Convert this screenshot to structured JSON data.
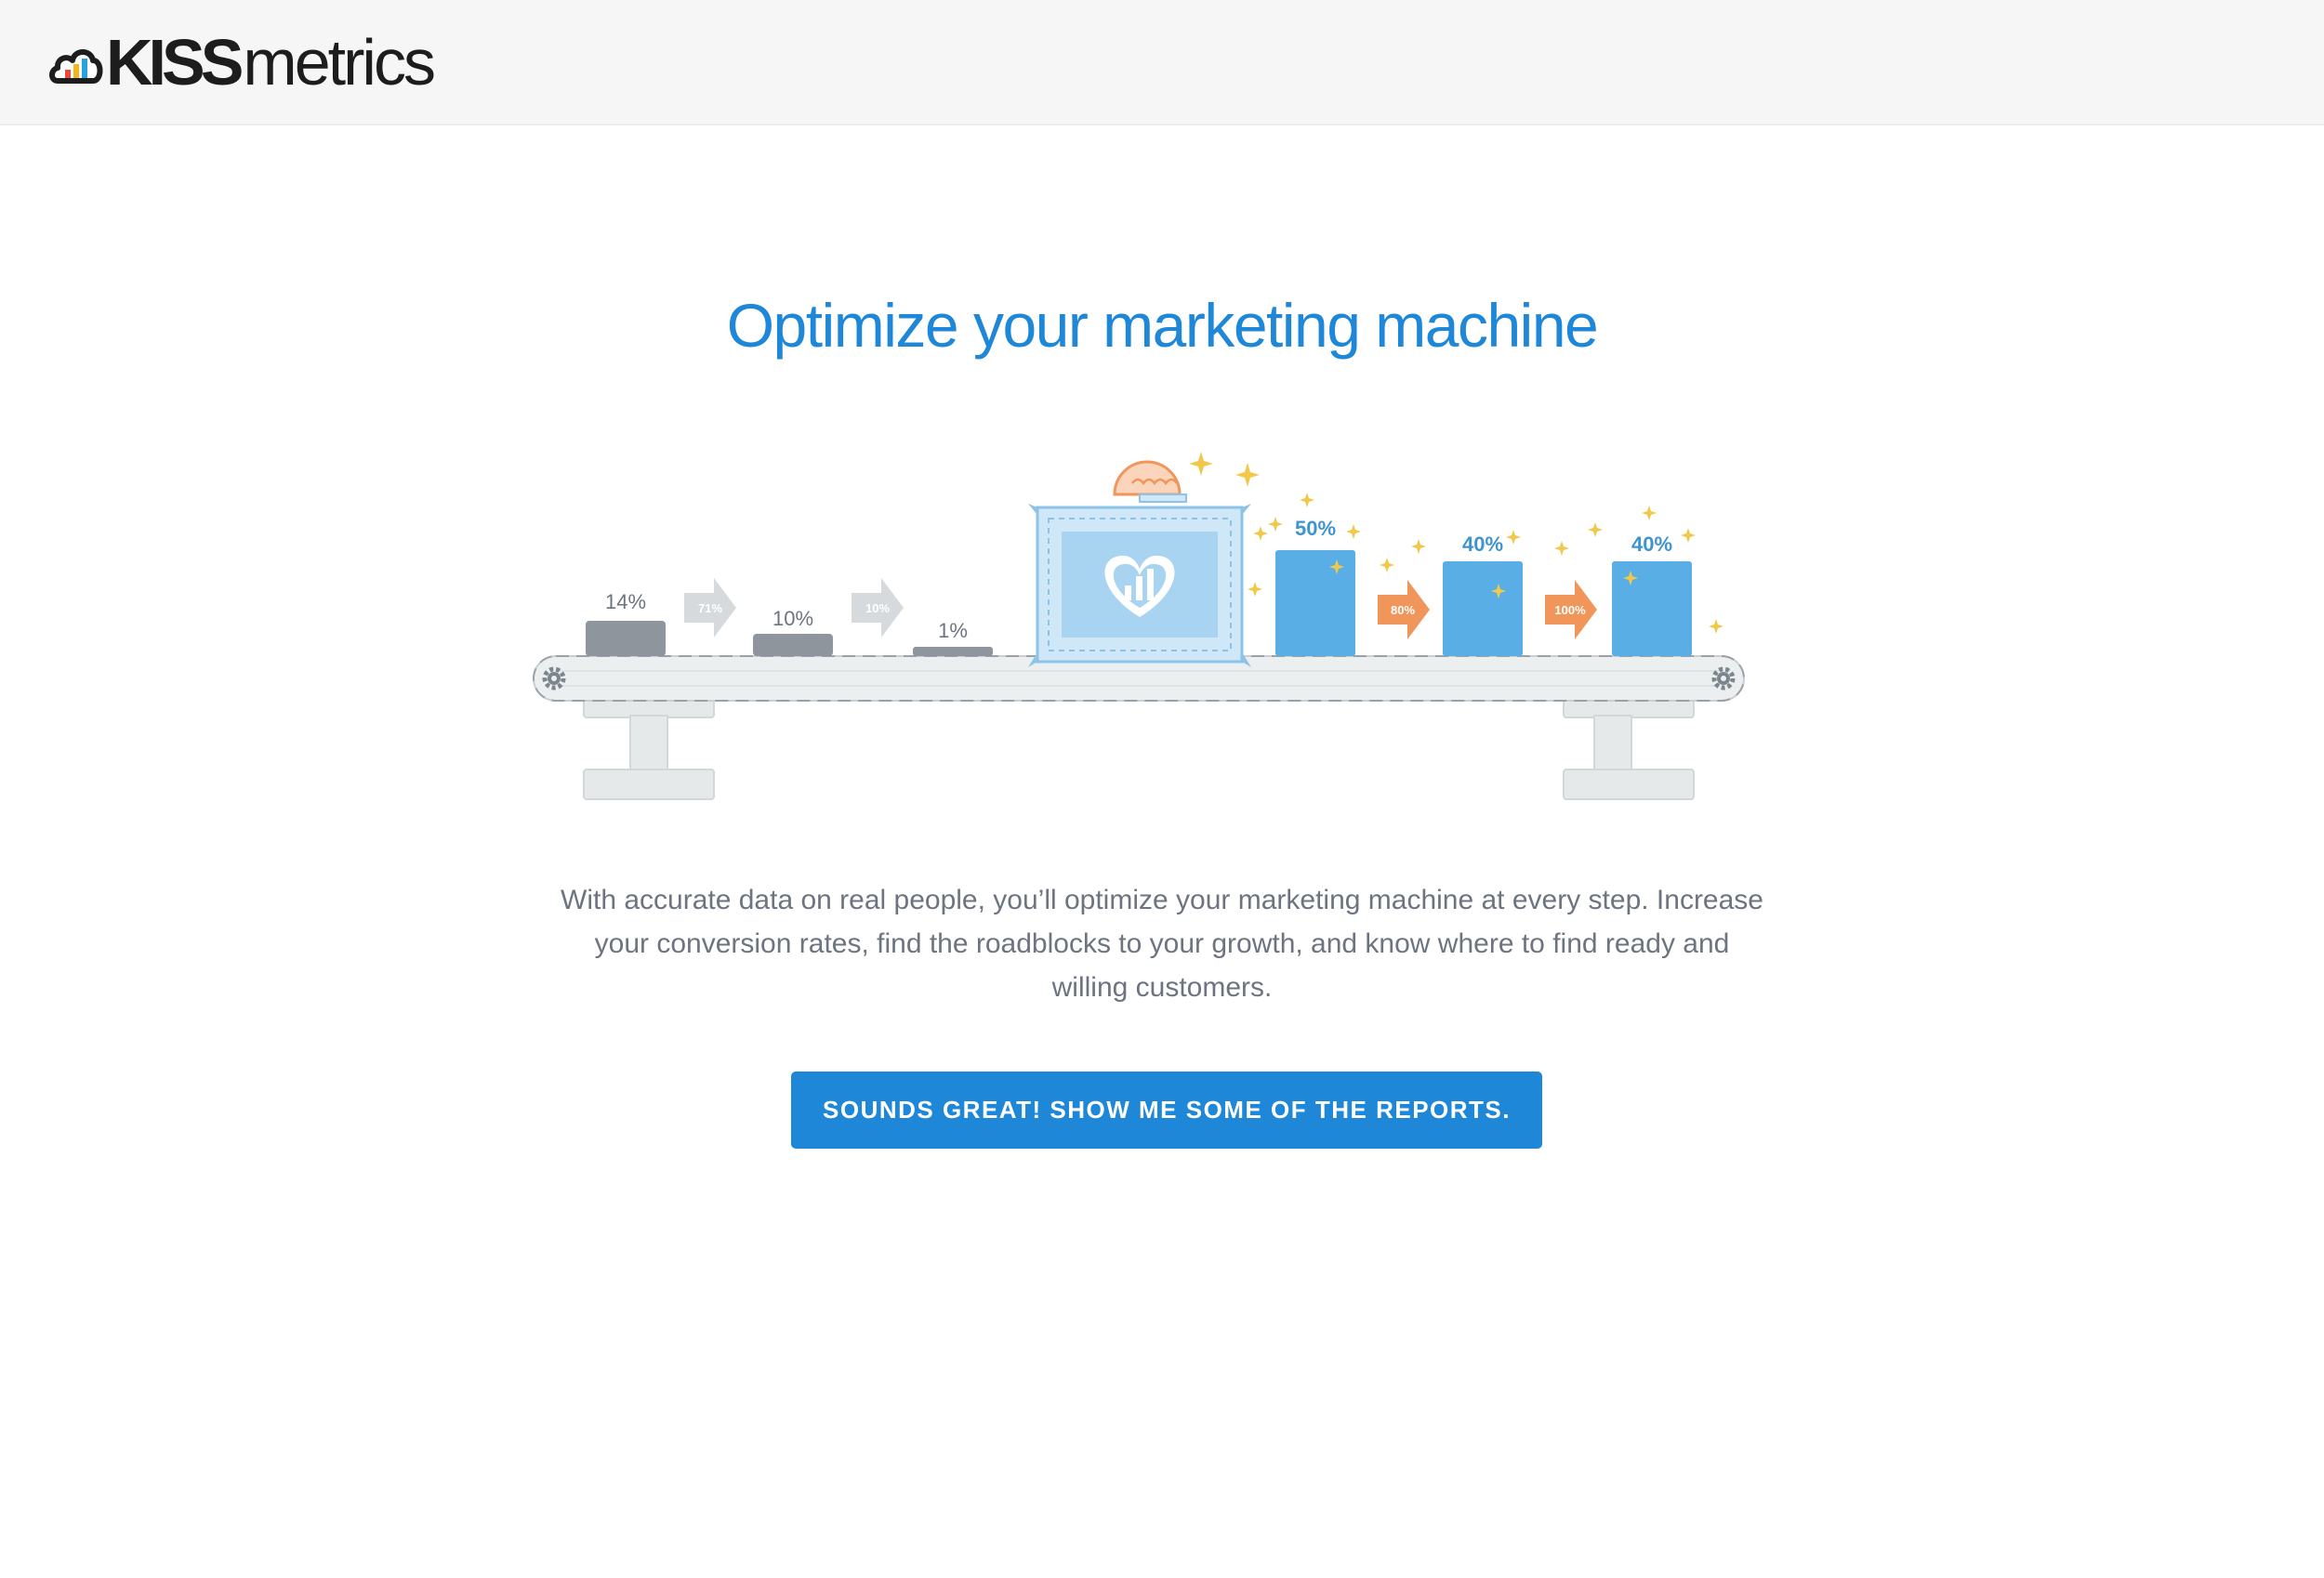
{
  "header": {
    "logo_bold": "KISS",
    "logo_light": "metrics"
  },
  "main": {
    "headline": "Optimize your marketing machine",
    "description": "With accurate data on real people, you’ll optimize your marketing machine at every step. Increase your conversion rates, find the roadblocks to your growth, and know where to find ready and willing customers.",
    "cta_label": "SOUNDS GREAT! SHOW ME SOME OF THE REPORTS."
  },
  "illustration": {
    "before_blocks": [
      {
        "label": "14%",
        "level": 14
      },
      {
        "label": "10%",
        "level": 10
      },
      {
        "label": "1%",
        "level": 1
      }
    ],
    "before_arrows": [
      "71%",
      "10%"
    ],
    "after_blocks": [
      {
        "label": "50%",
        "level": 50
      },
      {
        "label": "40%",
        "level": 40
      },
      {
        "label": "40%",
        "level": 40
      }
    ],
    "after_arrows": [
      "80%",
      "100%"
    ],
    "icons": [
      "gear-icon",
      "kissmetrics-heart-icon",
      "sparkle-icon",
      "arrow-right-icon"
    ]
  },
  "colors": {
    "brand_blue": "#1f87d8",
    "bar_blue": "#5aaee6",
    "bar_gray": "#8e959c",
    "arrow_orange": "#f0965a",
    "arrow_gray": "#d6dadd",
    "sparkle_gold": "#f2c84b",
    "text_gray": "#6c7480",
    "header_bg": "#f6f6f6"
  }
}
